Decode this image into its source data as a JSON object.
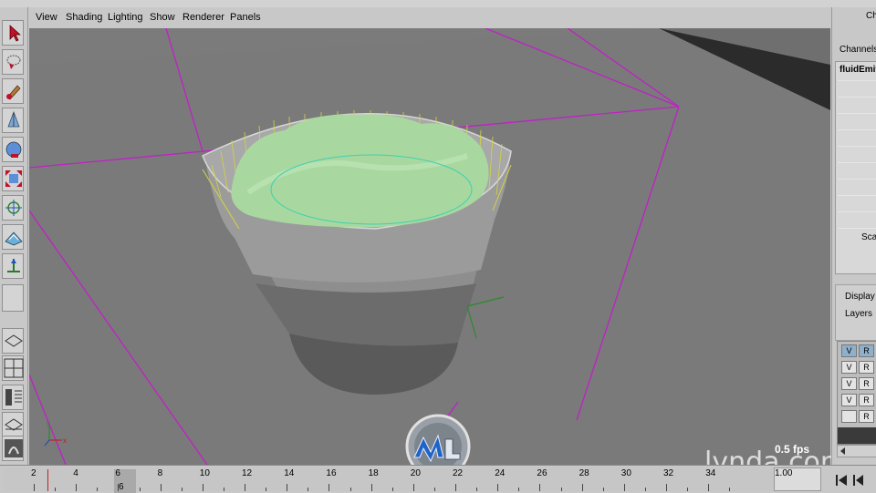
{
  "menu": {
    "items": [
      "View",
      "Shading",
      "Lighting",
      "Show",
      "Renderer",
      "Panels"
    ]
  },
  "toolbox": {
    "tools": [
      "select-tool-icon",
      "lasso-tool-icon",
      "paint-tool-icon",
      "move-tool-icon",
      "rotate-tool-icon",
      "scale-tool-icon",
      "manipulator-tool-icon",
      "soft-mod-tool-icon",
      "show-manipulator-icon",
      "last-tool-icon"
    ],
    "layouts": [
      "single-view-layout-icon",
      "four-view-layout-icon",
      "outliner-layout-icon",
      "persp-graph-layout-icon",
      "hypershade-layout-icon"
    ]
  },
  "viewport": {
    "fps_label": "0.5 fps",
    "watermark": "lynda.com",
    "axis_y": "y",
    "axis_x": "x"
  },
  "channel_box": {
    "title": "Ch",
    "channels_label": "Channels",
    "object_name": "fluidEmit",
    "scale_label": "Scal"
  },
  "layer_editor": {
    "display_tab": "Display",
    "layers_tab": "Layers",
    "rows": [
      {
        "v": "V",
        "r": "R",
        "selected": true
      },
      {
        "v": "V",
        "r": "R",
        "selected": false
      },
      {
        "v": "V",
        "r": "R",
        "selected": false
      },
      {
        "v": "V",
        "r": "R",
        "selected": false
      },
      {
        "v": "",
        "r": "R",
        "selected": false
      }
    ]
  },
  "timeline": {
    "tick_labels": [
      "2",
      "4",
      "6",
      "8",
      "10",
      "12",
      "14",
      "16",
      "18",
      "20",
      "22",
      "24",
      "26",
      "28",
      "30",
      "32",
      "34"
    ],
    "current_frame": "6",
    "end_field": "1.00"
  },
  "colors": {
    "viewport_bg": "#7b7b7b",
    "wireframe": "#c020c8",
    "fluid": "#a8d8a0",
    "container": "#9a9a9a"
  }
}
